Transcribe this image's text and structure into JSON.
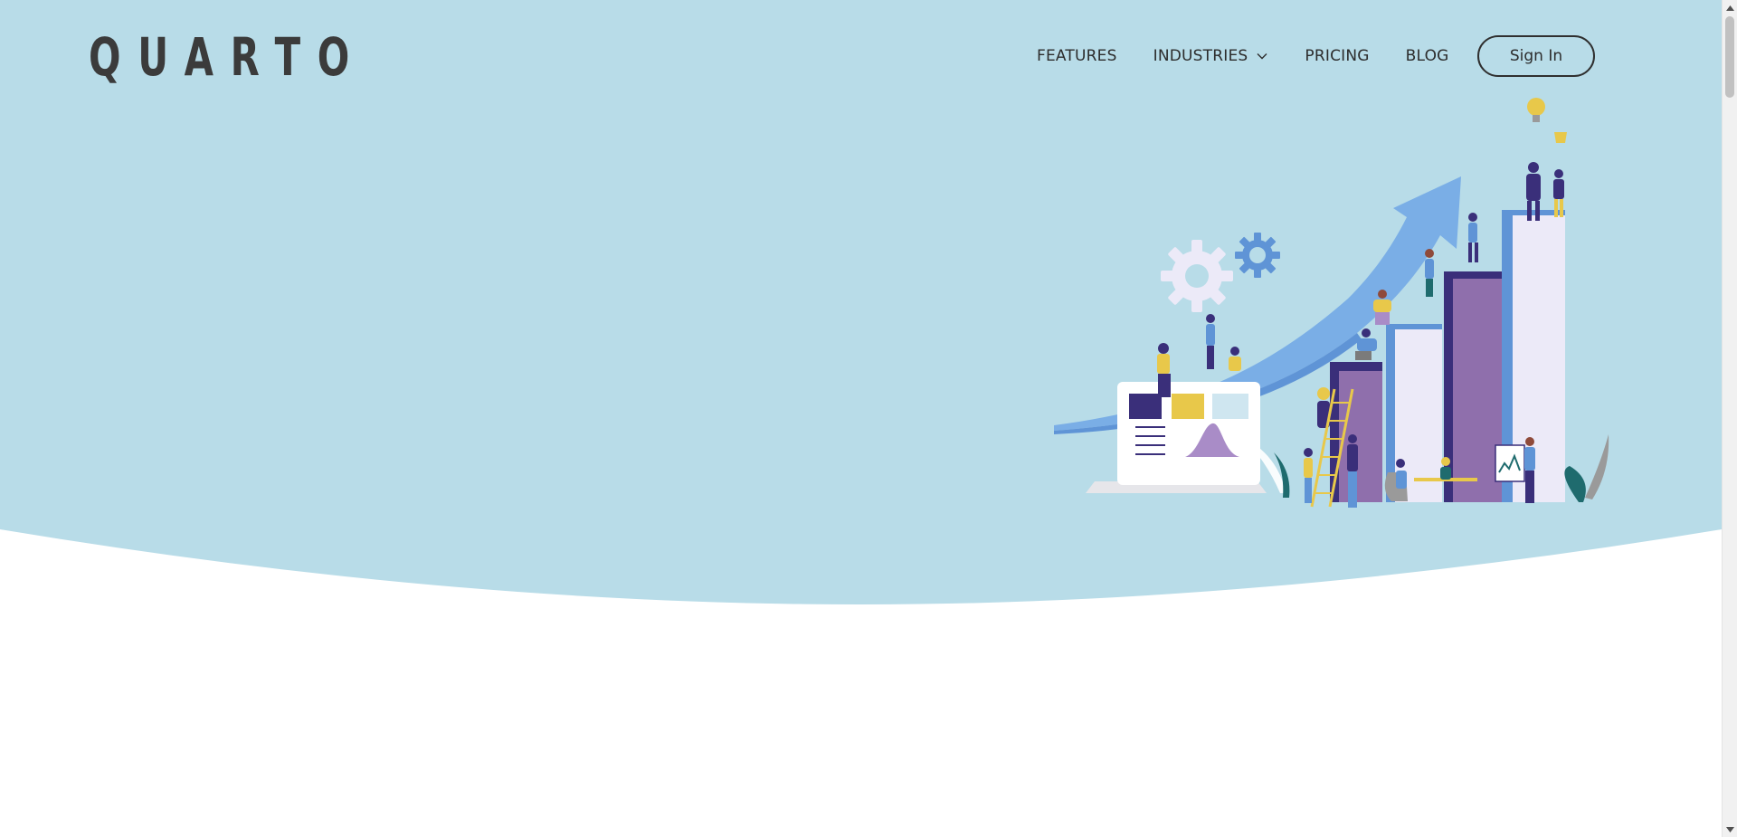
{
  "brand": {
    "logo_text": "QUARTO"
  },
  "nav": {
    "features": "FEATURES",
    "industries": "INDUSTRIES",
    "pricing": "PRICING",
    "blog": "BLOG",
    "sign_in": "Sign In"
  },
  "colors": {
    "hero_background": "#b8dce8",
    "text": "#2c2c2c",
    "bar_dark": "#3a2f7a",
    "bar_purple": "#8f6fac",
    "bar_light": "#eceaf8",
    "arrow_blue": "#7aaee6",
    "accent_yellow": "#e8c84a"
  },
  "icons": {
    "industries_dropdown": "chevron-down-icon",
    "scroll_up": "triangle-up-icon",
    "scroll_down": "triangle-down-icon"
  }
}
